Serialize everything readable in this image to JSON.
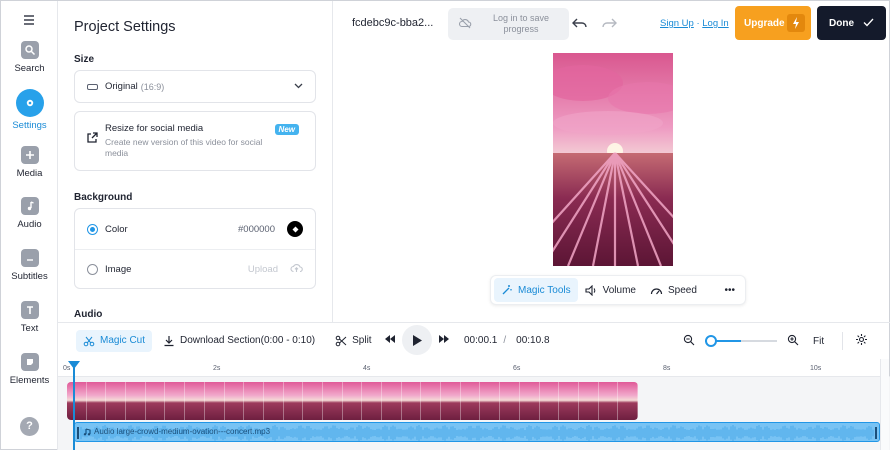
{
  "rail": {
    "items": [
      {
        "label": "Search",
        "icon": "search-icon"
      },
      {
        "label": "Settings",
        "icon": "settings-icon"
      },
      {
        "label": "Media",
        "icon": "media-icon"
      },
      {
        "label": "Audio",
        "icon": "audio-icon"
      },
      {
        "label": "Subtitles",
        "icon": "subtitles-icon"
      },
      {
        "label": "Text",
        "icon": "text-icon"
      },
      {
        "label": "Elements",
        "icon": "elements-icon"
      }
    ],
    "help": "?"
  },
  "panel": {
    "title": "Project Settings",
    "size_label": "Size",
    "size_value": "Original",
    "size_ratio": "(16:9)",
    "resize_title": "Resize for social media",
    "resize_sub": "Create new version of this video for social media",
    "resize_badge": "New",
    "background_label": "Background",
    "color_label": "Color",
    "color_value": "#000000",
    "image_label": "Image",
    "upload_label": "Upload",
    "cut_label": "Audio"
  },
  "topbar": {
    "project_name": "fcdebc9c-bba2...",
    "login_text": "Log in to save progress",
    "signup": "Sign Up",
    "auth_sep": "·",
    "login": "Log In",
    "upgrade": "Upgrade",
    "done": "Done"
  },
  "canvas_tools": {
    "magic_tools": "Magic Tools",
    "volume": "Volume",
    "speed": "Speed",
    "more": "•••"
  },
  "timeline": {
    "magic_cut": "Magic Cut",
    "download_section": "Download Section",
    "download_range": "(0:00 - 0:10)",
    "split": "Split",
    "current_time": "00:00.1",
    "time_sep": "/",
    "total_time": "00:10.8",
    "fit": "Fit",
    "ruler": [
      "0s",
      "2s",
      "4s",
      "6s",
      "8s",
      "10s"
    ],
    "audio_name": "Audio large-crowd-medium-ovation---concert.mp3",
    "zoom_level": 0.5
  },
  "colors": {
    "accent": "#2196e6",
    "upgrade": "#f7a01f",
    "done": "#141a2b",
    "audio_track": "#78c3f4"
  }
}
